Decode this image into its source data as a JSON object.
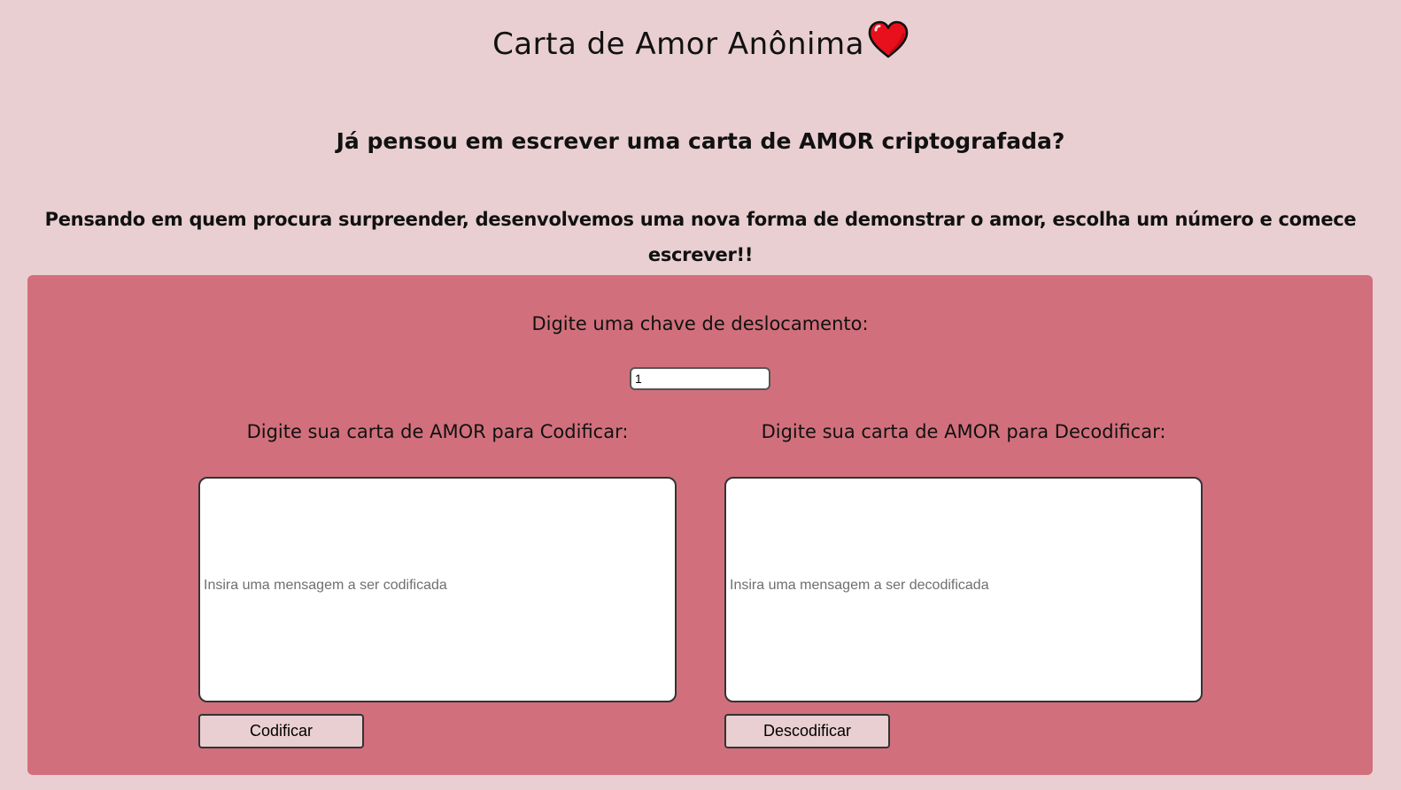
{
  "header": {
    "title": "Carta de Amor Anônima",
    "title_icon": "heart-icon",
    "subtitle": "Já pensou em escrever uma carta de AMOR criptografada?",
    "intro": "Pensando em quem procura surpreender, desenvolvemos uma nova forma de demonstrar o amor, escolha um número e comece escrever!!"
  },
  "colors": {
    "page_background": "#e9cfd1",
    "panel_background": "#d1707c",
    "heart": "#e8101c"
  },
  "form": {
    "shift_label": "Digite uma chave de deslocamento:",
    "shift_value": "1",
    "encode": {
      "label": "Digite sua carta de AMOR para Codificar:",
      "placeholder": "Insira uma mensagem a ser codificada",
      "button_label": "Codificar"
    },
    "decode": {
      "label": "Digite sua carta de AMOR para Decodificar:",
      "placeholder": "Insira uma mensagem a ser decodificada",
      "button_label": "Descodificar"
    }
  }
}
